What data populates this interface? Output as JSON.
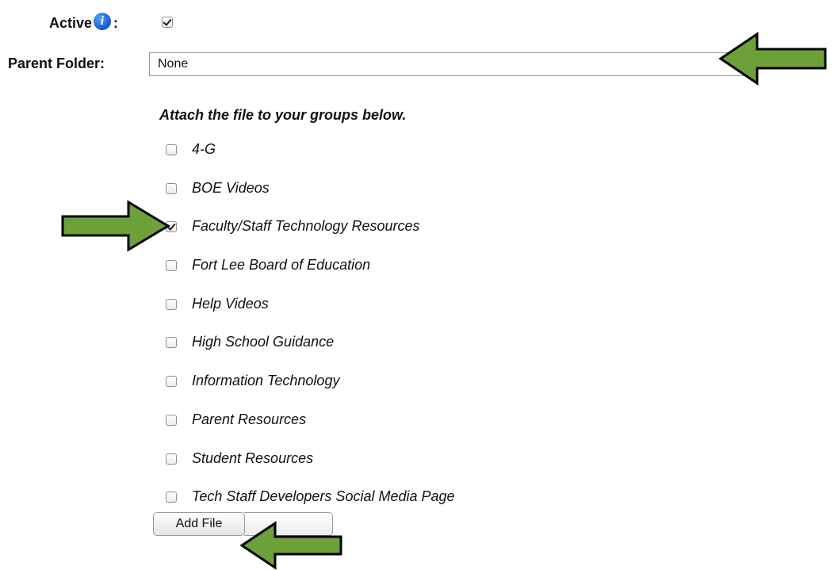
{
  "active": {
    "label": "Active",
    "info_icon_glyph": "i",
    "colon": ":",
    "checked": true
  },
  "parent_folder": {
    "label": "Parent Folder:",
    "value": "None"
  },
  "attach": {
    "heading": "Attach the file to your groups below."
  },
  "groups": [
    {
      "label": "4-G",
      "checked": false
    },
    {
      "label": "BOE Videos",
      "checked": false
    },
    {
      "label": "Faculty/Staff Technology Resources",
      "checked": true
    },
    {
      "label": "Fort Lee Board of Education",
      "checked": false
    },
    {
      "label": "Help Videos",
      "checked": false
    },
    {
      "label": "High School Guidance",
      "checked": false
    },
    {
      "label": "Information Technology",
      "checked": false
    },
    {
      "label": "Parent Resources",
      "checked": false
    },
    {
      "label": "Student Resources",
      "checked": false
    },
    {
      "label": "Tech Staff Developers Social Media Page",
      "checked": false
    }
  ],
  "actions": {
    "add_file_label": "Add File"
  },
  "annotations": {
    "arrow_fill": "#6ea03a",
    "arrow_stroke": "#000000"
  }
}
